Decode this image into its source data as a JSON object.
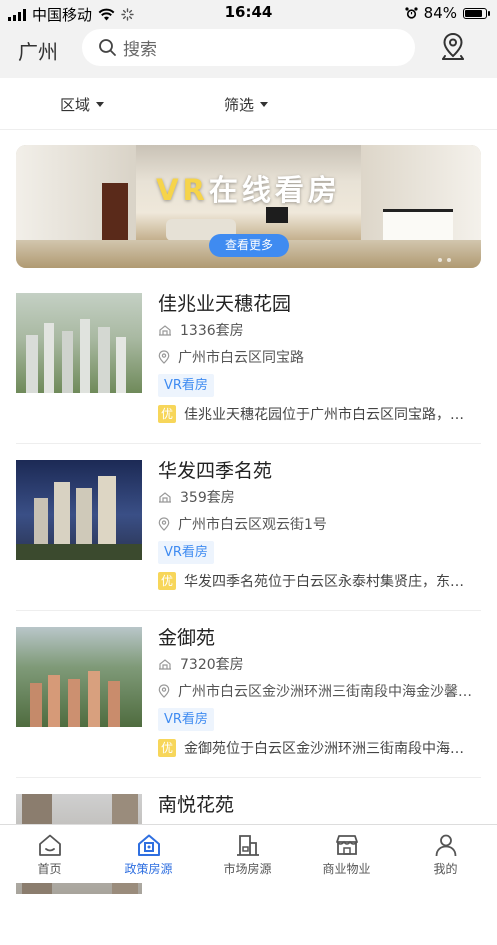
{
  "status_bar": {
    "carrier": "中国移动",
    "time": "16:44",
    "battery": "84%"
  },
  "header": {
    "city": "广州",
    "search_placeholder": "搜索",
    "location_icon": "map-pin-icon"
  },
  "filters": [
    {
      "label": "区域"
    },
    {
      "label": "筛选"
    }
  ],
  "banner": {
    "title_vr": "VR",
    "title_rest": "在线看房",
    "button": "查看更多"
  },
  "listings": [
    {
      "name": "佳兆业天穗花园",
      "units": "1336套房",
      "address": "广州市白云区同宝路",
      "tag": "VR看房",
      "badge": "优",
      "desc": "佳兆业天穗花园位于广州市白云区同宝路，…"
    },
    {
      "name": "华发四季名苑",
      "units": "359套房",
      "address": "广州市白云区观云街1号",
      "tag": "VR看房",
      "badge": "优",
      "desc": "华发四季名苑位于白云区永泰村集贤庄，东…"
    },
    {
      "name": "金御苑",
      "units": "7320套房",
      "address": "广州市白云区金沙洲环洲三街南段中海金沙馨…",
      "tag": "VR看房",
      "badge": "优",
      "desc": "金御苑位于白云区金沙洲环洲三街南段中海…"
    },
    {
      "name": "南悦花苑",
      "units": "",
      "address": "",
      "tag": "",
      "badge": "",
      "desc": ""
    }
  ],
  "tabbar": [
    {
      "label": "首页",
      "icon": "home-icon",
      "active": false
    },
    {
      "label": "政策房源",
      "icon": "policy-house-icon",
      "active": true
    },
    {
      "label": "市场房源",
      "icon": "market-house-icon",
      "active": false
    },
    {
      "label": "商业物业",
      "icon": "shop-icon",
      "active": false
    },
    {
      "label": "我的",
      "icon": "profile-icon",
      "active": false
    }
  ],
  "colors": {
    "accent": "#3f8bf1",
    "tab_active": "#2f6fe0",
    "badge": "#f7d65a",
    "tag_bg": "#edf4fd"
  }
}
